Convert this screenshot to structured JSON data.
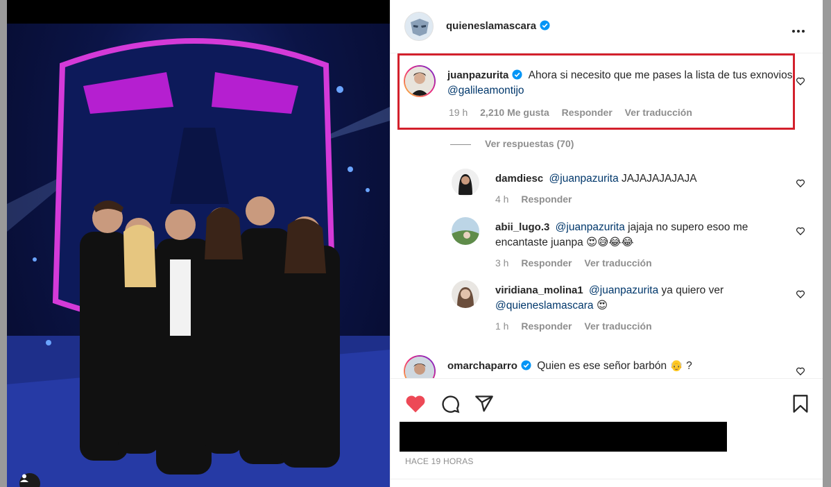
{
  "post": {
    "author": "quieneslamascara",
    "time_ago": "HACE 19 HORAS"
  },
  "comments": [
    {
      "user": "juanpazurita",
      "verified": true,
      "text": "Ahora si necesito que me pases la lista de tus exnovios",
      "mention": "@galileamontijo",
      "time": "19 h",
      "likes": "2,210 Me gusta",
      "reply": "Responder",
      "translate": "Ver traducción"
    },
    {
      "user": "omarchaparro",
      "verified": true,
      "text": "Quien es ese señor barbón",
      "emoji": "👴",
      "suffix": "?"
    }
  ],
  "view_replies": "Ver respuestas (70)",
  "replies": [
    {
      "user": "damdiesc",
      "mention": "@juanpazurita",
      "text": "JAJAJAJAJAJA",
      "time": "4 h",
      "reply": "Responder"
    },
    {
      "user": "abii_lugo.3",
      "mention": "@juanpazurita",
      "text": "jajaja no supero esoo me encantaste juanpa",
      "emoji": "😍😅😂😂",
      "time": "3 h",
      "reply": "Responder",
      "translate": "Ver traducción"
    },
    {
      "user": "viridiana_molina1",
      "mention": "@juanpazurita",
      "text": "ya quiero ver",
      "mention2": "@quieneslamascara",
      "emoji": "😍",
      "time": "1 h",
      "reply": "Responder",
      "translate": "Ver traducción"
    }
  ],
  "colors": {
    "verified": "#0095f6",
    "like_red": "#ed4956",
    "highlight_red": "#d3202c",
    "mention": "#00376b"
  },
  "icons": [
    "heart-icon",
    "comment-icon",
    "share-icon",
    "bookmark-icon",
    "more-icon",
    "verified-icon",
    "user-tag-icon"
  ]
}
